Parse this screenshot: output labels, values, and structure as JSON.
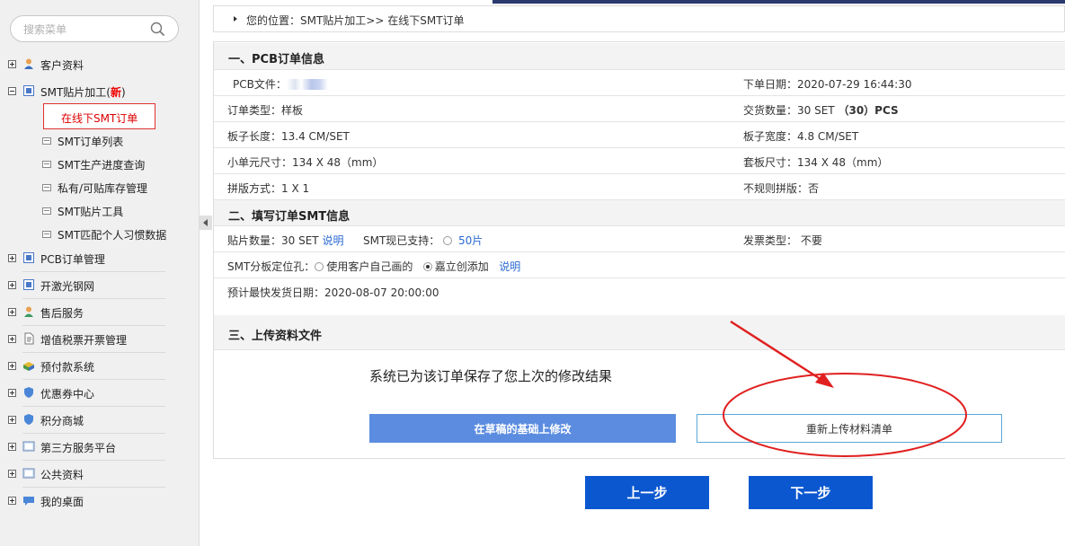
{
  "sidebar": {
    "search_placeholder": "搜索菜单",
    "items": [
      {
        "label": "客户资料",
        "icon": "customer-icon"
      },
      {
        "label": "SMT贴片加工(",
        "new": "新",
        "close": ")",
        "icon": "smt-icon"
      },
      {
        "label": "PCB订单管理",
        "icon": "pcb-icon"
      },
      {
        "label": "开激光钢网",
        "icon": "stencil-icon"
      },
      {
        "label": "售后服务",
        "icon": "service-icon"
      },
      {
        "label": "增值税票开票管理",
        "icon": "invoice-icon"
      },
      {
        "label": "预付款系统",
        "icon": "prepay-icon"
      },
      {
        "label": "优惠券中心",
        "icon": "coupon-icon"
      },
      {
        "label": "积分商城",
        "icon": "points-icon"
      },
      {
        "label": "第三方服务平台",
        "icon": "thirdparty-icon"
      },
      {
        "label": "公共资料",
        "icon": "public-icon"
      },
      {
        "label": "我的桌面",
        "icon": "desktop-icon"
      }
    ],
    "sub_items": [
      {
        "label": "在线下SMT订单"
      },
      {
        "label": "SMT订单列表"
      },
      {
        "label": "SMT生产进度查询"
      },
      {
        "label": "私有/可贴库存管理"
      },
      {
        "label": "SMT贴片工具"
      },
      {
        "label": "SMT匹配个人习惯数据"
      }
    ]
  },
  "breadcrumb": {
    "label": "您的位置：",
    "value": "SMT贴片加工>> 在线下SMT订单"
  },
  "section1": {
    "title": "一、PCB订单信息",
    "pcb_file_label": "PCB文件：",
    "order_date_label": "下单日期：",
    "order_date": "2020-07-29 16:44:30",
    "order_type_label": "订单类型：",
    "order_type": "样板",
    "delivery_qty_label": "交货数量：",
    "delivery_qty": "30 SET",
    "delivery_pcs": "（30）PCS",
    "board_length_label": "板子长度：",
    "board_length": "13.4 CM/SET",
    "board_width_label": "板子宽度：",
    "board_width": "4.8 CM/SET",
    "unit_size_label": "小单元尺寸：",
    "unit_size": "134 X 48（mm）",
    "panel_size_label": "套板尺寸：",
    "panel_size": "134 X 48（mm）",
    "panel_mode_label": "拼版方式：",
    "panel_mode": "1 X 1",
    "irregular_label": "不规则拼版：",
    "irregular": "否"
  },
  "section2": {
    "title": "二、填写订单SMT信息",
    "qty_label": "贴片数量：",
    "qty": "30 SET",
    "explain": "说明",
    "support_label": "SMT现已支持：",
    "support_option": "50片",
    "invoice_label": "发票类型：",
    "invoice": "不要",
    "hole_label": "SMT分板定位孔：",
    "hole_opt1": "使用客户自己画的",
    "hole_opt2": "嘉立创添加",
    "hole_explain": "说明",
    "ship_label": "预计最快发货日期：",
    "ship_date": "2020-08-07 20:00:00"
  },
  "section3": {
    "title": "三、上传资料文件",
    "saved_msg": "系统已为该订单保存了您上次的修改结果",
    "modify_btn": "在草稿的基础上修改",
    "reupload_btn": "重新上传材料清单"
  },
  "nav": {
    "prev": "上一步",
    "next": "下一步"
  },
  "colors": {
    "nav_blue": "#0b57d0",
    "modify_blue": "#5b8ce0",
    "annotation_red": "#e02020",
    "new_red": "#e00000"
  }
}
